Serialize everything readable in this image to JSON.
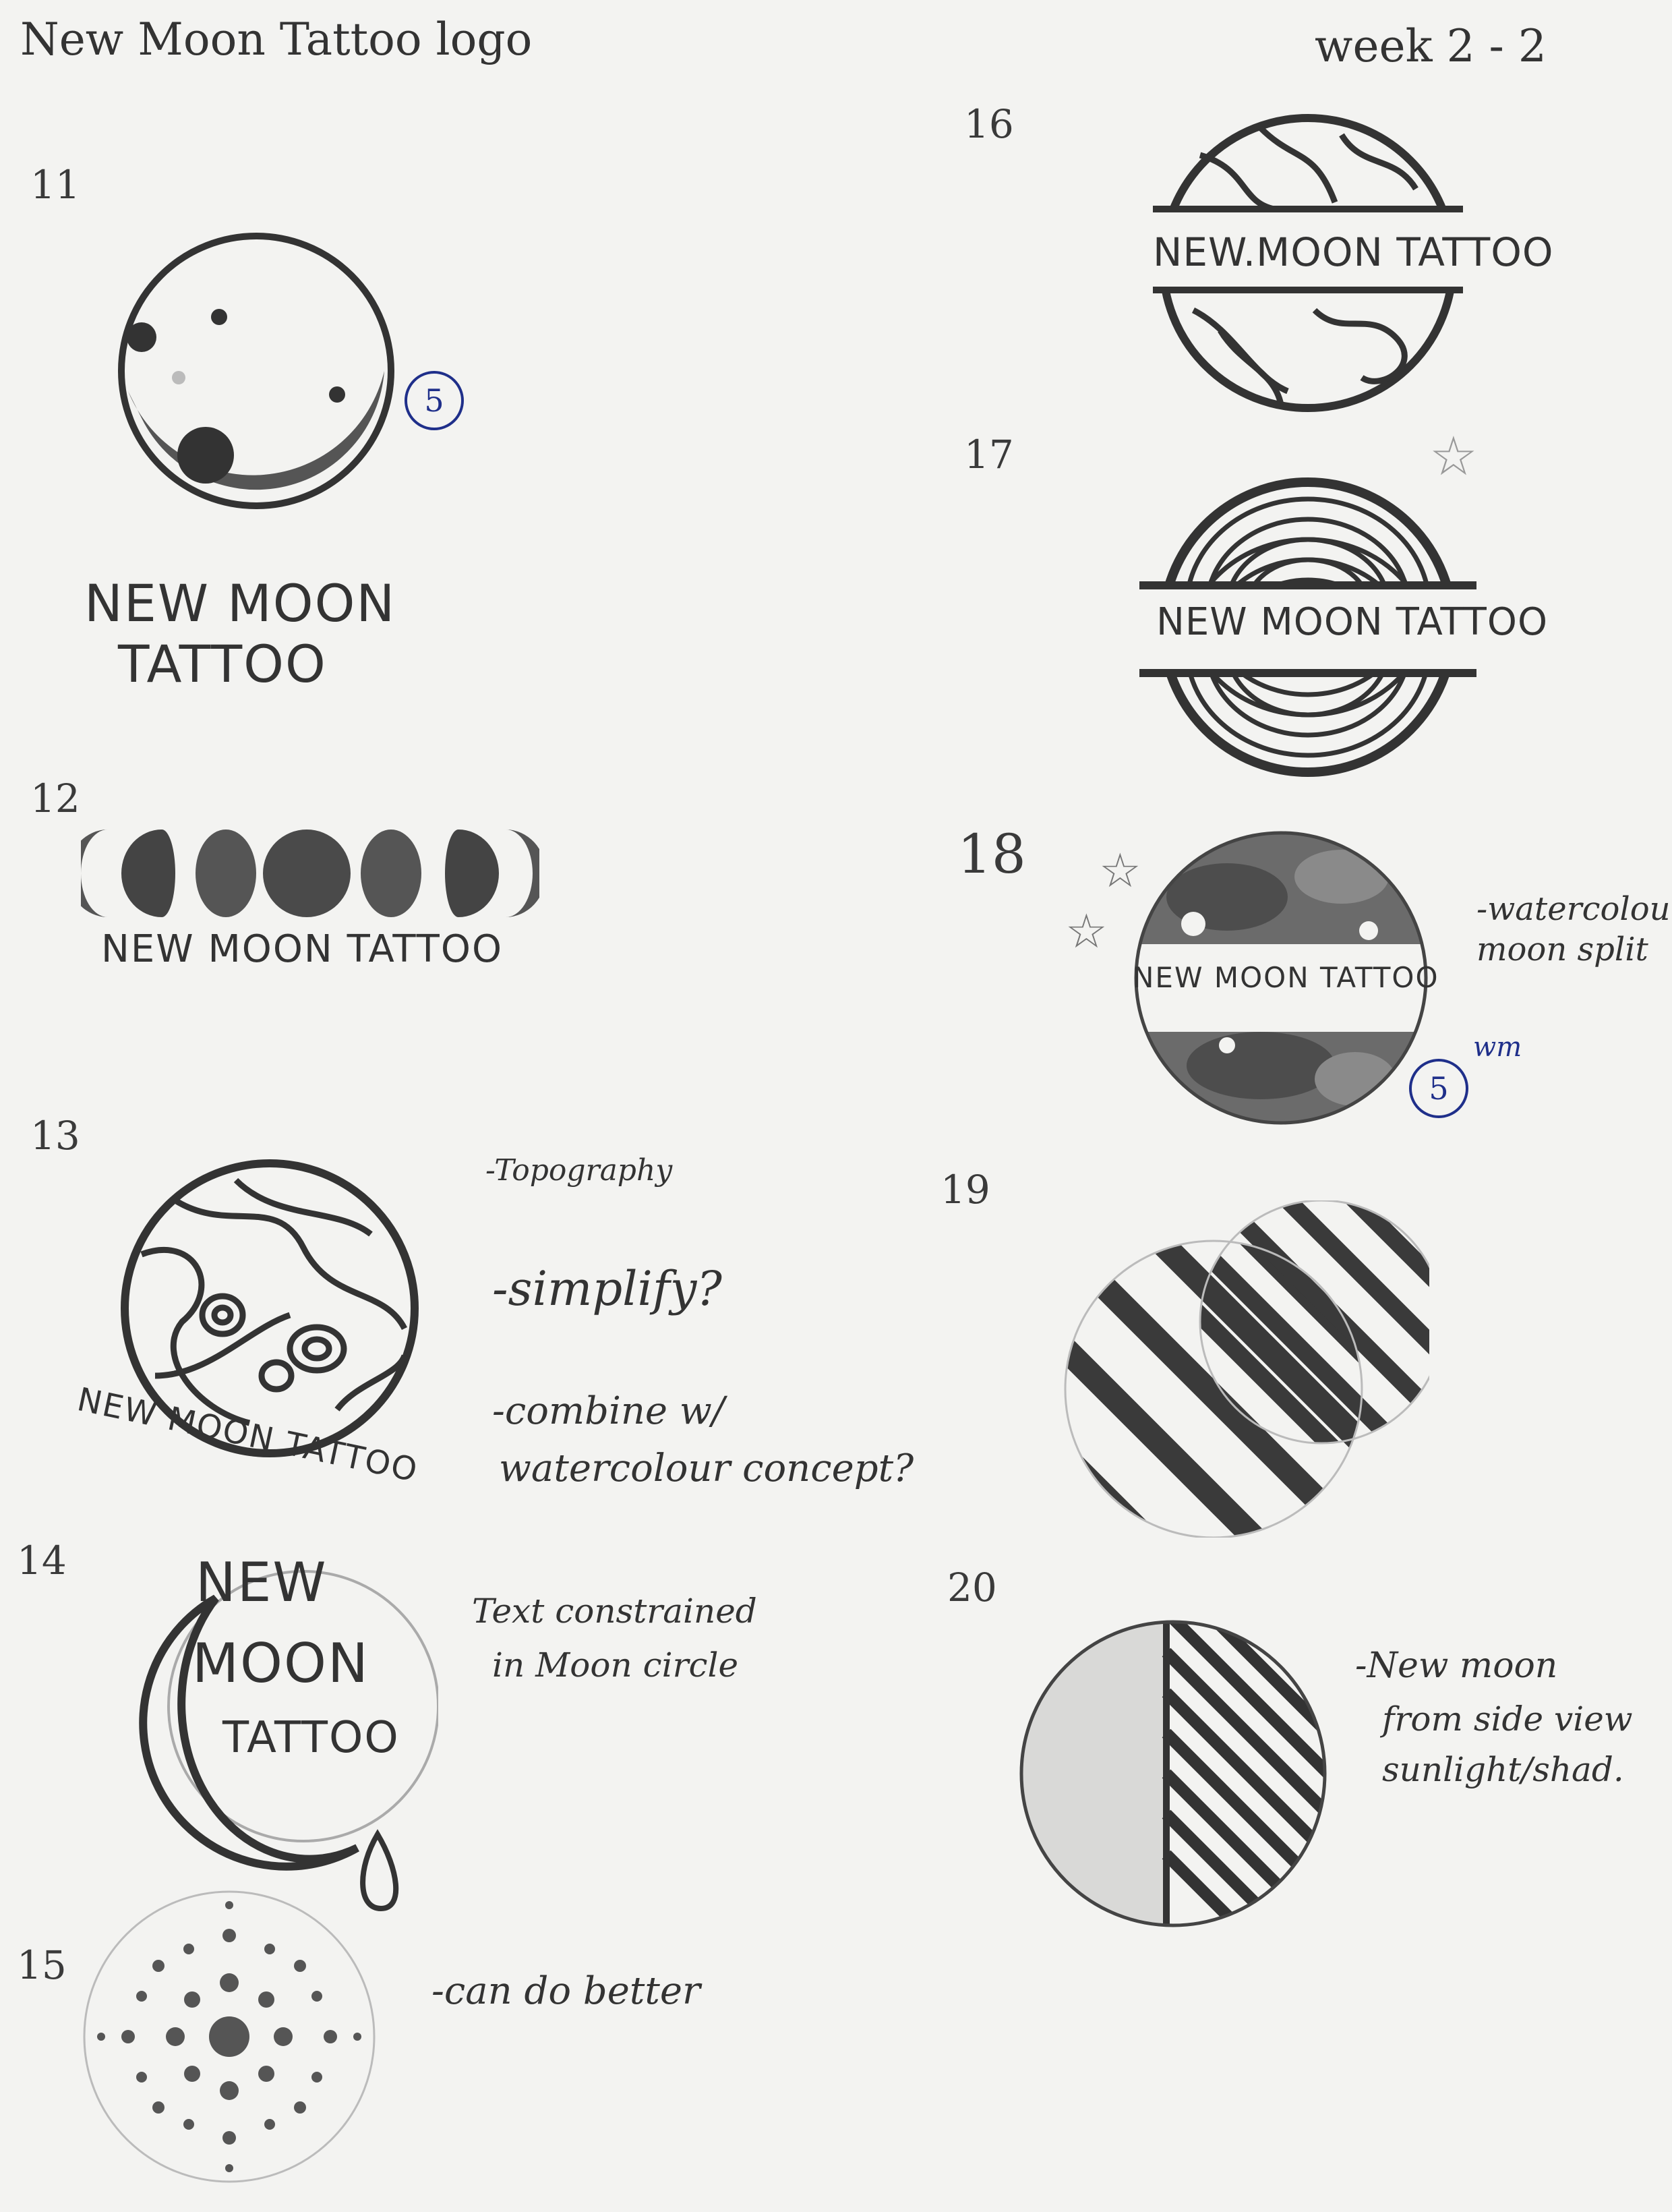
{
  "header": {
    "title": "New Moon Tattoo logo",
    "week": "week 2 - 2"
  },
  "sketches": [
    {
      "num": "11",
      "label_line1": "NEW MOON",
      "label_line2": "TATTOO",
      "rating": "5"
    },
    {
      "num": "12",
      "label": "NEW MOON TATTOO"
    },
    {
      "num": "13",
      "label": "NEW MOON TATTOO",
      "notes": [
        "-Topography",
        "-simplify?",
        "-combine w/",
        "watercolour concept?"
      ]
    },
    {
      "num": "14",
      "text_lines": [
        "NEW",
        "MOON",
        "TATTOO"
      ],
      "notes": [
        "Text constrained",
        "in Moon circle"
      ]
    },
    {
      "num": "15",
      "notes": [
        "-can do better"
      ]
    },
    {
      "num": "16",
      "label": "NEW.MOON TATTOO"
    },
    {
      "num": "17",
      "label": "NEW MOON TATTOO"
    },
    {
      "num": "18",
      "label": "NEW MOON TATTOO",
      "notes": [
        "-watercolour",
        "moon split"
      ],
      "rating": "5",
      "rating_note": "wm"
    },
    {
      "num": "19"
    },
    {
      "num": "20",
      "notes": [
        "-New moon",
        "from side view",
        "sunlight/shad."
      ]
    }
  ]
}
